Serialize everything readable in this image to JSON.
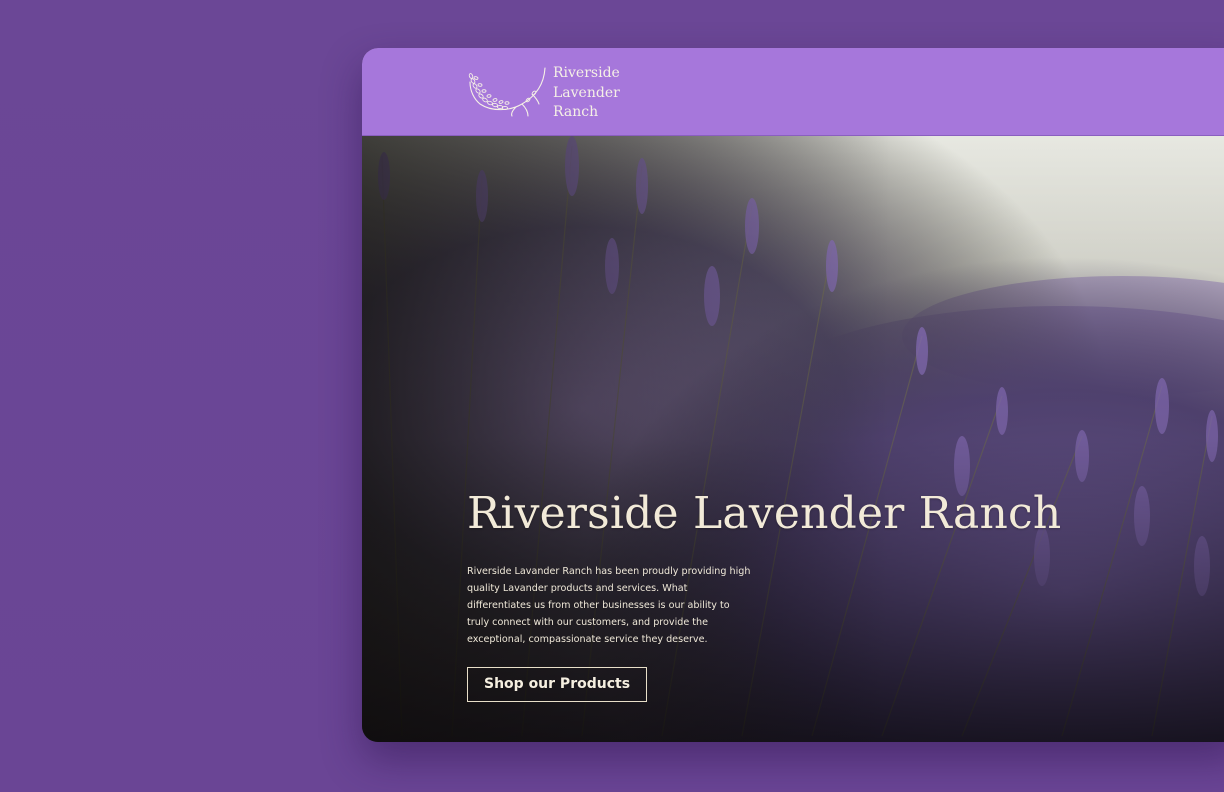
{
  "header": {
    "logo_lines": [
      "Riverside",
      "Lavender",
      "Ranch"
    ]
  },
  "hero": {
    "title": "Riverside Lavender Ranch",
    "description": "Riverside Lavander Ranch has been proudly providing high quality Lavander products and services. What differentiates us from other businesses is our ability to truly connect with our customers, and provide the exceptional, compassionate service they deserve.",
    "cta_label": "Shop our Products"
  },
  "colors": {
    "background": "#6a4696",
    "header": "#a677db",
    "hero_text": "#f2ead8"
  },
  "icons": {
    "logo": "lavender-sprig-icon"
  }
}
